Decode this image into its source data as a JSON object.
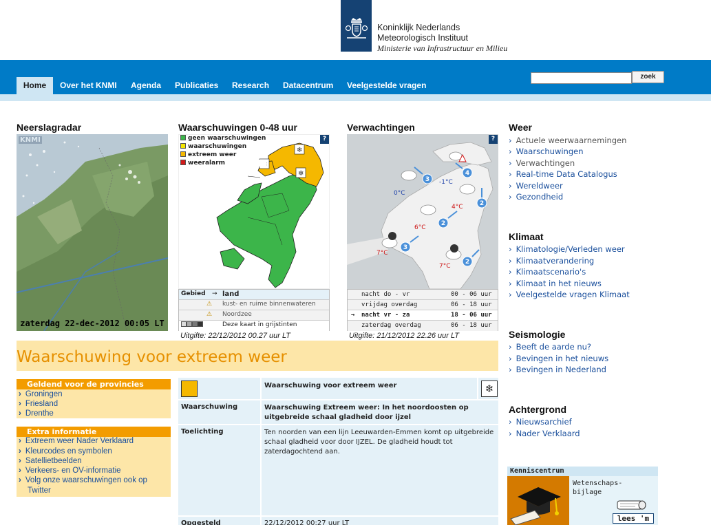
{
  "header": {
    "org_line1": "Koninklijk Nederlands",
    "org_line2": "Meteorologisch Instituut",
    "org_line3": "Ministerie van Infrastructuur en Milieu",
    "brand_color": "#154273"
  },
  "nav": {
    "items": [
      "Home",
      "Over het KNMI",
      "Agenda",
      "Publicaties",
      "Research",
      "Datacentrum",
      "Veelgestelde vragen"
    ],
    "active": "Home",
    "bar_color": "#007bc7"
  },
  "search": {
    "value": "",
    "button_label": "zoek"
  },
  "radar": {
    "heading": "Neerslagradar",
    "watermark": "KNMI",
    "timestamp": "zaterdag 22-dec-2012 00:05 LT"
  },
  "warnings": {
    "heading": "Waarschuwingen 0-48 uur",
    "help": "?",
    "legend": [
      {
        "label": "geen waarschuwingen",
        "color": "#3cb54a"
      },
      {
        "label": "waarschuwingen",
        "color": "#f5e600"
      },
      {
        "label": "extreem weer",
        "color": "#f5b800"
      },
      {
        "label": "weeralarm",
        "color": "#d21a1a"
      }
    ],
    "table": {
      "gebied_label": "Gebied",
      "arrow": "→",
      "gebied_value": "land",
      "rows": [
        "kust- en ruime binnenwateren",
        "Noordzee"
      ],
      "greyscale": "Deze kaart in grijstinten"
    },
    "uitgifte": "Uitgifte: 22/12/2012 00.27 uur LT"
  },
  "forecast": {
    "heading": "Verwachtingen",
    "help": "?",
    "temps": [
      "0°C",
      "-1°C",
      "4°C",
      "6°C",
      "7°C",
      "7°C"
    ],
    "wind": [
      "3",
      "4",
      "2",
      "2",
      "3",
      "2"
    ],
    "rows": [
      {
        "period": "nacht do - vr",
        "time": "00 - 06 uur",
        "active": false
      },
      {
        "period": "vrijdag overdag",
        "time": "06 - 18 uur",
        "active": false
      },
      {
        "period": "nacht vr - za",
        "time": "18 - 06 uur",
        "active": true
      },
      {
        "period": "zaterdag overdag",
        "time": "06 - 18 uur",
        "active": false
      }
    ],
    "active_arrow": "→",
    "uitgifte": "Uitgifte: 21/12/2012 22.26 uur LT"
  },
  "banner": {
    "title": "Waarschuwing voor extreem weer",
    "color": "#e69000"
  },
  "provinces": {
    "heading": "Geldend voor de provincies",
    "items": [
      "Groningen",
      "Friesland",
      "Drenthe"
    ]
  },
  "extra": {
    "heading": "Extra informatie",
    "items": [
      "Extreem weer Nader Verklaard",
      "Kleurcodes en symbolen",
      "Satellietbeelden",
      "Verkeers- en OV-informatie",
      "Volg onze waarschuwingen ook op",
      "Twitter"
    ]
  },
  "detail": {
    "title": "Waarschuwing voor extreem weer",
    "rows": [
      {
        "label": "Waarschuwing",
        "value": "Waarschuwing Extreem weer: In het noordoosten op uitgebreide schaal gladheid door ijzel"
      },
      {
        "label": "Toelichting",
        "value": "Ten noorden van een lijn Leeuwarden-Emmen komt op uitgebreide schaal gladheid voor door IJZEL. De gladheid houdt tot zaterdagochtend aan."
      },
      {
        "label": "Opgesteld",
        "value": "22/12/2012 00:27 uur LT"
      }
    ]
  },
  "sidebar": {
    "weer": {
      "heading": "Weer",
      "items": [
        "Actuele weerwaarnemingen",
        "Waarschuwingen",
        "Verwachtingen",
        "Real-time Data Catalogus",
        "Wereldweer",
        "Gezondheid"
      ]
    },
    "klimaat": {
      "heading": "Klimaat",
      "items": [
        "Klimatologie/Verleden weer",
        "Klimaatverandering",
        "Klimaatscenario's",
        "Klimaat in het nieuws",
        "Veelgestelde vragen Klimaat"
      ]
    },
    "seismologie": {
      "heading": "Seismologie",
      "items": [
        "Beeft de aarde nu?",
        "Bevingen in het nieuws",
        "Bevingen in Nederland"
      ]
    },
    "achtergrond": {
      "heading": "Achtergrond",
      "items": [
        "Nieuwsarchief",
        "Nader Verklaard"
      ]
    }
  },
  "kenniscentrum": {
    "heading": "Kenniscentrum",
    "text_line1": "Wetenschaps-",
    "text_line2": "bijlage",
    "button": "lees 'm"
  }
}
